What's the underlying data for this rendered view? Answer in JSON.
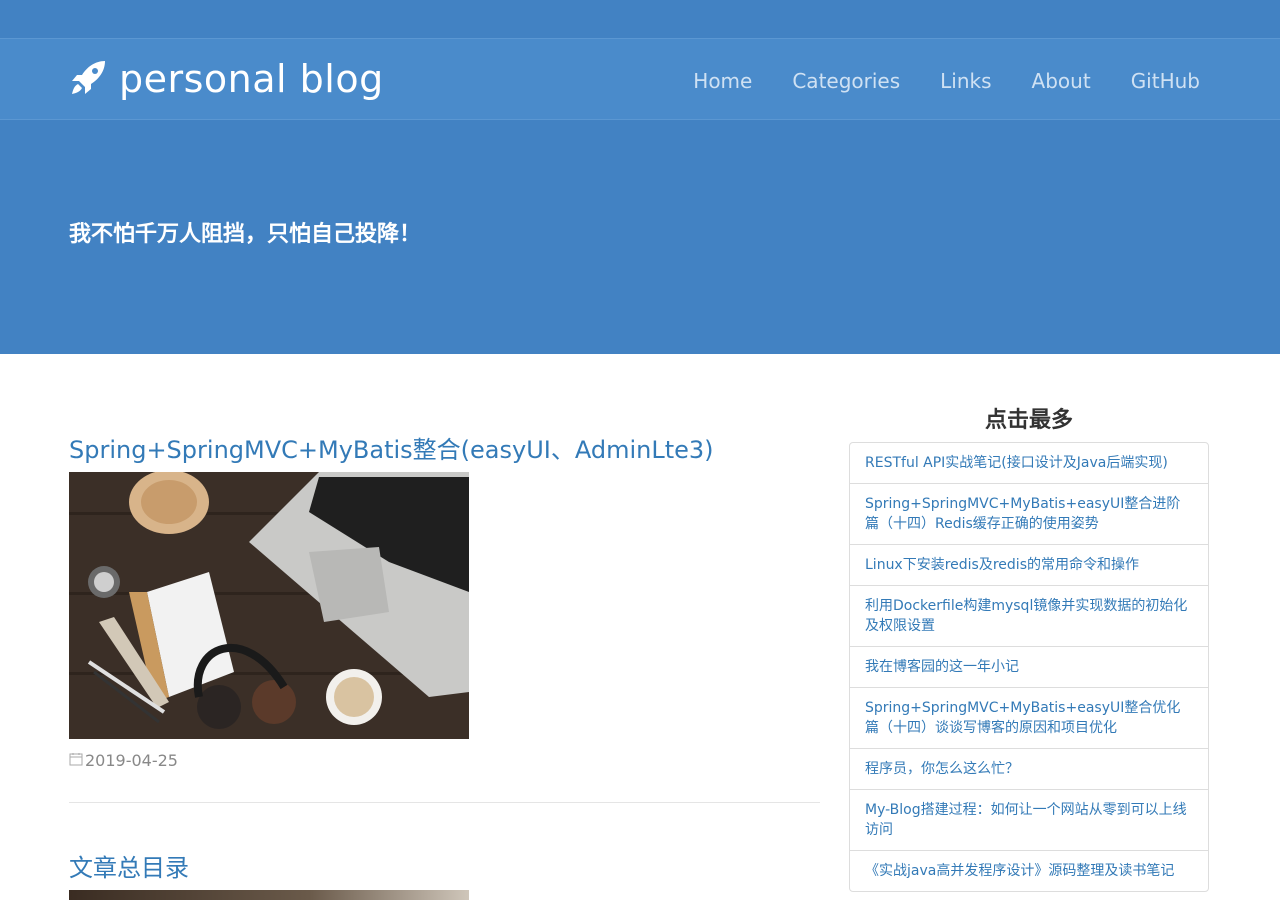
{
  "brand": {
    "name": "personal blog",
    "icon": "rocket-icon"
  },
  "nav": [
    {
      "label": "Home"
    },
    {
      "label": "Categories"
    },
    {
      "label": "Links"
    },
    {
      "label": "About"
    },
    {
      "label": "GitHub"
    }
  ],
  "hero": {
    "tagline": "我不怕千万人阻挡，只怕自己投降！"
  },
  "posts": [
    {
      "title": "Spring+SpringMVC+MyBatis整合(easyUI、AdminLte3)",
      "date": "2019-04-25"
    },
    {
      "title": "文章总目录"
    }
  ],
  "sidebar": {
    "title": "点击最多",
    "items": [
      {
        "label": "RESTful API实战笔记(接口设计及Java后端实现)"
      },
      {
        "label": "Spring+SpringMVC+MyBatis+easyUI整合进阶篇（十四）Redis缓存正确的使用姿势"
      },
      {
        "label": "Linux下安装redis及redis的常用命令和操作"
      },
      {
        "label": "利用Dockerfile构建mysql镜像并实现数据的初始化及权限设置"
      },
      {
        "label": "我在博客园的这一年小记"
      },
      {
        "label": "Spring+SpringMVC+MyBatis+easyUI整合优化篇（十四）谈谈写博客的原因和项目优化"
      },
      {
        "label": "程序员，你怎么这么忙？"
      },
      {
        "label": "My-Blog搭建过程：如何让一个网站从零到可以上线访问"
      },
      {
        "label": "《实战java高并发程序设计》源码整理及读书笔记"
      }
    ]
  },
  "colors": {
    "header_bg": "#4282c3",
    "link": "#337ab7"
  }
}
